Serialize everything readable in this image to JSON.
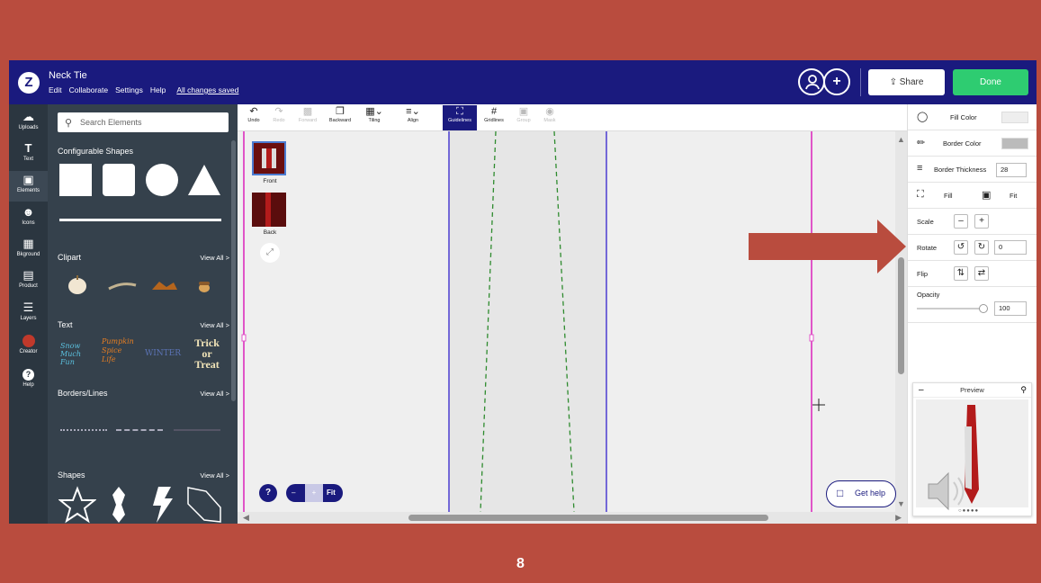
{
  "header": {
    "logo_letter": "Z",
    "doc_title": "Neck Tie",
    "menu": [
      "Edit",
      "Collaborate",
      "Settings",
      "Help"
    ],
    "saved_status": "All changes saved",
    "share_label": "Share",
    "done_label": "Done",
    "plus_label": "+"
  },
  "leftnav": [
    {
      "label": "Uploads",
      "icon": "upload-cloud-icon"
    },
    {
      "label": "Text",
      "icon": "text-icon"
    },
    {
      "label": "Elements",
      "icon": "elements-icon"
    },
    {
      "label": "Icons",
      "icon": "icons-icon"
    },
    {
      "label": "Bkground",
      "icon": "background-icon"
    },
    {
      "label": "Product",
      "icon": "product-icon"
    },
    {
      "label": "Layers",
      "icon": "layers-icon"
    },
    {
      "label": "Creator",
      "icon": "creator-avatar"
    },
    {
      "label": "Help",
      "icon": "help-icon"
    }
  ],
  "panel": {
    "search_placeholder": "Search Elements",
    "sections": {
      "configurable": "Configurable Shapes",
      "clipart": "Clipart",
      "text": "Text",
      "borders": "Borders/Lines",
      "shapes": "Shapes"
    },
    "view_all": "View All >",
    "text_samples": [
      "Snow Much Fun",
      "Pumpkin Spice Life",
      "WINTER",
      "Trick or Treat"
    ]
  },
  "toolbar": [
    {
      "label": "Undo",
      "icon": "undo-icon",
      "state": "enabled"
    },
    {
      "label": "Redo",
      "icon": "redo-icon",
      "state": "disabled"
    },
    {
      "label": "Forward",
      "icon": "forward-icon",
      "state": "disabled"
    },
    {
      "label": "Backward",
      "icon": "backward-icon",
      "state": "enabled"
    },
    {
      "label": "Tiling",
      "icon": "tiling-icon",
      "state": "enabled"
    },
    {
      "label": "Align",
      "icon": "align-icon",
      "state": "enabled"
    },
    {
      "label": "Guidelines",
      "icon": "guidelines-icon",
      "state": "selected"
    },
    {
      "label": "Gridlines",
      "icon": "gridlines-icon",
      "state": "enabled"
    },
    {
      "label": "Group",
      "icon": "group-icon",
      "state": "disabled"
    },
    {
      "label": "Mask",
      "icon": "mask-icon",
      "state": "disabled"
    }
  ],
  "pages": [
    {
      "label": "Front"
    },
    {
      "label": "Back"
    }
  ],
  "properties": {
    "fill_color": "Fill Color",
    "border_color": "Border Color",
    "border_thickness": "Border Thickness",
    "border_thickness_value": "28",
    "fill": "Fill",
    "fit": "Fit",
    "scale": "Scale",
    "rotate": "Rotate",
    "rotate_value": "0",
    "flip": "Flip",
    "opacity": "Opacity",
    "opacity_value": "100"
  },
  "preview": {
    "title": "Preview"
  },
  "get_help": "Get help",
  "zoom": {
    "minus": "–",
    "plus": "+",
    "fit": "Fit"
  },
  "help_q": "?",
  "slide_number": "8",
  "colors": {
    "brand": "#1a1a7e",
    "done": "#2ecc71",
    "slide_bg": "#b94c3e",
    "tie": "#b31b1b"
  }
}
